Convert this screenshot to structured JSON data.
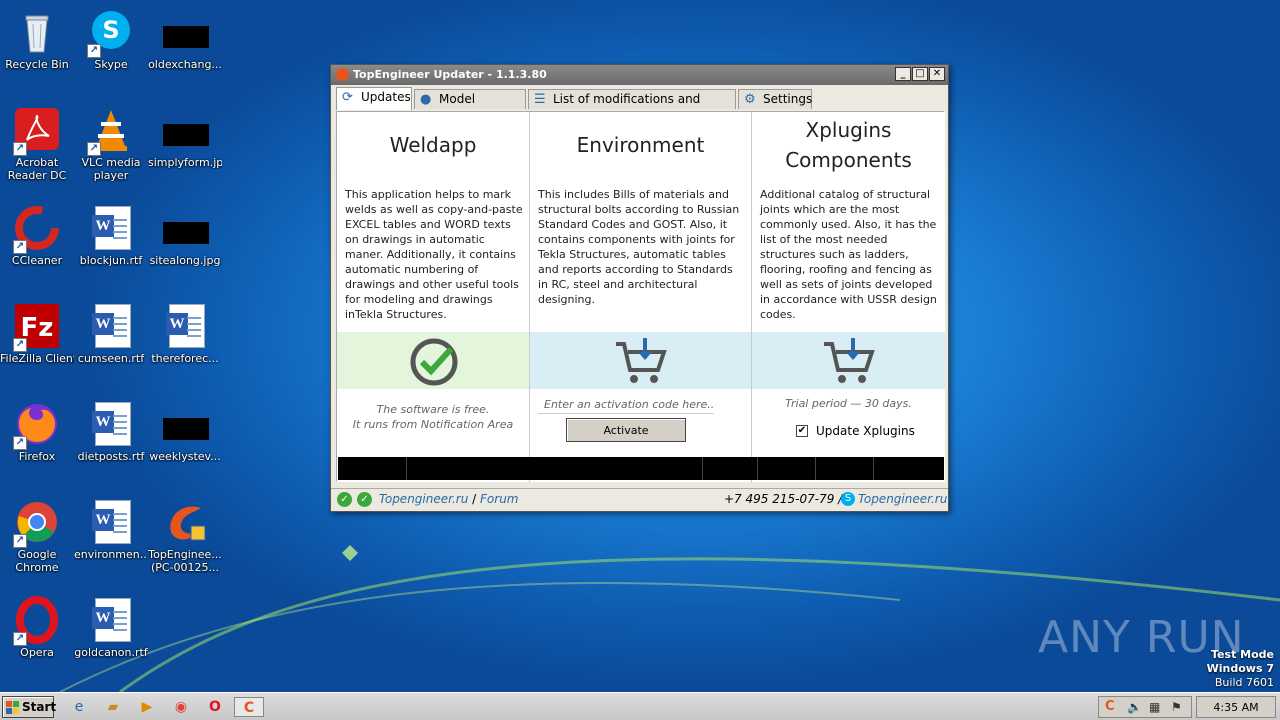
{
  "desktop": {
    "icons": [
      {
        "label": "Recycle Bin",
        "icon": "recycle-bin-icon"
      },
      {
        "label": "Skype",
        "icon": "skype-icon"
      },
      {
        "label": "oldexchang...",
        "icon": "image-file-icon"
      },
      {
        "label": "Acrobat Reader DC",
        "icon": "acrobat-icon"
      },
      {
        "label": "VLC media player",
        "icon": "vlc-icon"
      },
      {
        "label": "simplyform.jpg",
        "icon": "image-file-icon"
      },
      {
        "label": "CCleaner",
        "icon": "ccleaner-icon"
      },
      {
        "label": "blockjun.rtf",
        "icon": "word-document-icon"
      },
      {
        "label": "sitealong.jpg",
        "icon": "image-file-icon"
      },
      {
        "label": "FileZilla Client",
        "icon": "filezilla-icon"
      },
      {
        "label": "cumseen.rtf",
        "icon": "word-document-icon"
      },
      {
        "label": "thereforec...",
        "icon": "word-document-icon"
      },
      {
        "label": "Firefox",
        "icon": "firefox-icon"
      },
      {
        "label": "dietposts.rtf",
        "icon": "word-document-icon"
      },
      {
        "label": "weeklystev...",
        "icon": "image-file-icon"
      },
      {
        "label": "Google Chrome",
        "icon": "chrome-icon"
      },
      {
        "label": "environmen...",
        "icon": "word-document-icon"
      },
      {
        "label": "TopEnginee... (PC-00125...",
        "icon": "topengineer-icon"
      },
      {
        "label": "Opera",
        "icon": "opera-icon"
      },
      {
        "label": "goldcanon.rtf",
        "icon": "word-document-icon"
      }
    ]
  },
  "window": {
    "title": "TopEngineer Updater - 1.1.3.80",
    "tabs": [
      {
        "label": "Updates",
        "icon": "refresh-icon"
      },
      {
        "label": "Model backups",
        "icon": "disk-icon"
      },
      {
        "label": "List of modifications and updates",
        "icon": "list-icon"
      },
      {
        "label": "Settings",
        "icon": "gear-icon"
      }
    ],
    "columns": [
      {
        "title": "Weldapp",
        "description": "This application helps to mark welds as well as copy-and-paste EXCEL tables and WORD texts on drawings in automatic maner. Additionally, it contains automatic numbering of drawings and other useful tools for modeling and drawings inTekla Structures.",
        "status_icon": "checkmark-icon",
        "note_line1": "The software is free.",
        "note_line2": "It runs from Notification Area"
      },
      {
        "title": "Environment",
        "description": "This includes Bills of materials and structural bolts according to Russian Standard Codes and GOST. Also, it contains components with joints for Tekla Structures, automatic tables and reports according to Standards in RC, steel and architectural designing.",
        "status_icon": "cart-download-icon",
        "activation_placeholder": "Enter an activation code here...",
        "activate_label": "Activate"
      },
      {
        "title_line1": "Xplugins",
        "title_line2": "Components",
        "description": "Additional catalog of structural joints which are the most commonly used. Also, it has the list of the most needed structures such as ladders, flooring, roofing and fencing as well as sets of joints developed in accordance with USSR design codes.",
        "status_icon": "cart-download-icon",
        "note": "Trial period — 30 days.",
        "checkbox_label": "Update Xplugins",
        "checkbox_checked": true
      }
    ],
    "status": {
      "link1": "Topengineer.ru",
      "sep": "/",
      "link2": "Forum",
      "phone": "+7 495 215-07-79 /",
      "skype_link": "Topengineer.ru"
    }
  },
  "taskbar": {
    "start_label": "Start",
    "clock": "4:35 AM"
  },
  "watermark": "ANY RUN",
  "test_mode": {
    "line1": "Test Mode",
    "line2": "Windows 7",
    "line3": "Build 7601"
  },
  "colors": {
    "accent_green": "#3ca83c",
    "accent_blue": "#2a6aa8",
    "green_band": "#e3f6dc",
    "blue_band": "#d9eef4"
  }
}
